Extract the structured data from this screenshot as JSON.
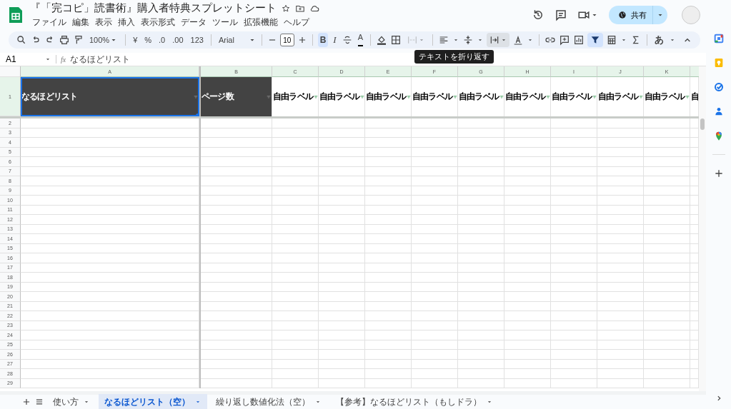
{
  "document": {
    "title": "『「完コピ」読書術』購入者特典スプレットシート",
    "starred": false
  },
  "menu": [
    "ファイル",
    "編集",
    "表示",
    "挿入",
    "表示形式",
    "データ",
    "ツール",
    "拡張機能",
    "ヘルプ"
  ],
  "share_button": {
    "label": "共有"
  },
  "toolbar": {
    "zoom": "100%",
    "currency": "¥",
    "percent": "%",
    "decrease_decimals": ".0",
    "increase_decimals": ".00",
    "number_format": "123",
    "font": "Arial",
    "font_size": "10",
    "bold": "B",
    "bold_selected": true,
    "italic": "I",
    "text_color": "A",
    "merge_disabled": true,
    "filter_selected": true,
    "input_tool": "あ",
    "tooltip": "テキストを折り返す"
  },
  "formula_bar": {
    "cell": "A1",
    "fx": "fx",
    "value": "なるほどリスト"
  },
  "columns": [
    "A",
    "B",
    "C",
    "D",
    "E",
    "F",
    "G",
    "H",
    "I",
    "J",
    "K"
  ],
  "header_row": {
    "label": "1",
    "cells": [
      {
        "text": "なるほどリスト",
        "kind": "dark",
        "filter": true,
        "selected": true
      },
      {
        "text": "ページ数",
        "kind": "dark",
        "filter": true,
        "selected": false
      },
      {
        "text": "自由ラベル",
        "kind": "plain",
        "filter": true,
        "selected": false
      },
      {
        "text": "自由ラベル",
        "kind": "plain",
        "filter": true,
        "selected": false
      },
      {
        "text": "自由ラベル",
        "kind": "plain",
        "filter": true,
        "selected": false
      },
      {
        "text": "自由ラベル",
        "kind": "plain",
        "filter": true,
        "selected": false
      },
      {
        "text": "自由ラベル",
        "kind": "plain",
        "filter": true,
        "selected": false
      },
      {
        "text": "自由ラベル",
        "kind": "plain",
        "filter": true,
        "selected": false
      },
      {
        "text": "自由ラベル",
        "kind": "plain",
        "filter": true,
        "selected": false
      },
      {
        "text": "自由ラベル",
        "kind": "plain",
        "filter": true,
        "selected": false
      },
      {
        "text": "自由ラベル",
        "kind": "plain",
        "filter": true,
        "selected": false
      },
      {
        "text": "自",
        "kind": "plain",
        "filter": false,
        "selected": false
      }
    ]
  },
  "rows": [
    "2",
    "3",
    "4",
    "5",
    "6",
    "7",
    "8",
    "9",
    "10",
    "11",
    "12",
    "13",
    "14",
    "15",
    "16",
    "17",
    "18",
    "19",
    "20",
    "21",
    "22",
    "23",
    "24",
    "25",
    "26",
    "27",
    "28",
    "29"
  ],
  "sheet_tabs": [
    {
      "label": "使い方",
      "selected": false
    },
    {
      "label": "なるほどリスト（空）",
      "selected": true
    },
    {
      "label": "繰り返し数値化法（空）",
      "selected": false
    },
    {
      "label": "【参考】なるほどリスト（もしドラ）",
      "selected": false
    }
  ]
}
